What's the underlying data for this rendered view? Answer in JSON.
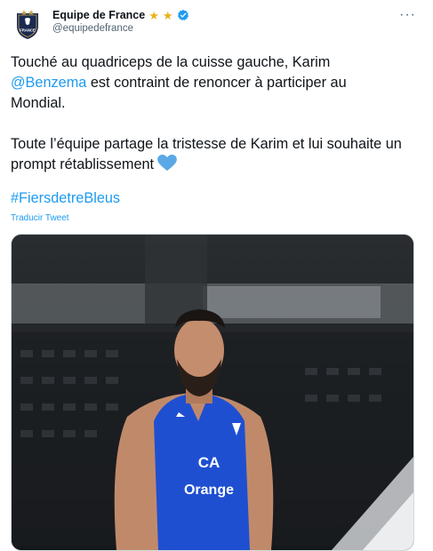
{
  "account": {
    "name": "Equipe de France",
    "handle": "@equipedefrance",
    "badges": [
      "star-icon",
      "star-icon",
      "verified-badge-icon"
    ],
    "avatar_text": "FRANCE",
    "avatar_icon": "fff-crest-icon"
  },
  "menu_icon": "more-horizontal-icon",
  "tweet": {
    "para1_start": "Touché au quadriceps de la cuisse gauche, Karim",
    "mention": "@Benzema",
    "para1_end": " est contraint de renoncer à participer au Mondial.",
    "para2": "Toute l’équipe partage la tristesse de Karim et lui souhaite un prompt rétablissement",
    "emoji": "blue-heart-icon",
    "hashtag": "#FiersdetreBleus",
    "translate_label": "Traducir Tweet"
  },
  "media": {
    "kind": "photo",
    "jersey_sponsor_line1": "CA",
    "jersey_sponsor_line2": "Orange",
    "colors": {
      "jersey": "#1f4fd1",
      "accent": "#1d9bf0"
    }
  }
}
